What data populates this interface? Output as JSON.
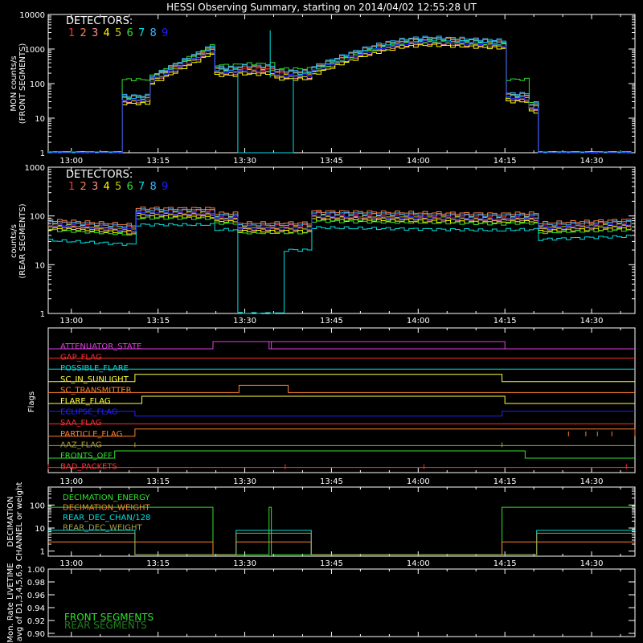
{
  "title": "HESSI Observing Summary, starting on 2014/04/02 12:55:28 UT",
  "colors": {
    "det1": "#ff3333",
    "det2": "#ff8040",
    "det3": "#ff9090",
    "det4": "#ffff00",
    "det5": "#c8c800",
    "det6": "#30e030",
    "det7": "#00e0e0",
    "det8": "#3cb4ff",
    "det9": "#2020ff",
    "magenta": "#e040e0",
    "red": "#ff3030",
    "cyan": "#00e0e0",
    "yellow": "#ffff40",
    "orange": "#ff8030",
    "blue": "#2020ff",
    "olive": "#a8a040",
    "green": "#30e030"
  },
  "chart_data": [
    {
      "type": "line",
      "name": "front",
      "ylabel": "MON counts/s\n(FRONT SEGMENTS)",
      "scale": "log",
      "ylim": [
        1,
        10000
      ],
      "yticks": [
        1,
        10,
        100,
        1000,
        10000
      ],
      "ytick_labels": [
        "1",
        "10",
        "100",
        "1000",
        "10000"
      ],
      "xlim_minutes": [
        -4,
        36.5
      ],
      "xticks": [
        [
          0,
          "13:00"
        ],
        [
          15,
          "13:15"
        ],
        [
          30,
          "13:30"
        ],
        [
          45,
          "13:45"
        ],
        [
          60,
          "14:00"
        ],
        [
          75,
          "14:15"
        ],
        [
          90,
          "14:30"
        ]
      ],
      "legend_title": "DETECTORS:",
      "legend_items": [
        "1",
        "2",
        "3",
        "4",
        "5",
        "6",
        "7",
        "8",
        "9"
      ]
    },
    {
      "type": "line",
      "name": "rear",
      "ylabel": "counts/s\n(REAR SEGMENTS)",
      "scale": "log",
      "ylim": [
        1,
        1000
      ],
      "yticks": [
        1,
        10,
        100,
        1000
      ],
      "ytick_labels": [
        "1",
        "10",
        "100",
        "1000"
      ],
      "legend_title": "DETECTORS:",
      "legend_items": [
        "1",
        "2",
        "3",
        "4",
        "5",
        "6",
        "7",
        "8",
        "9"
      ]
    },
    {
      "type": "flags",
      "ylabel": "Flags",
      "flags": [
        {
          "label": "ATTENUATOR_STATE",
          "color": "magenta"
        },
        {
          "label": "GAP_FLAG",
          "color": "red"
        },
        {
          "label": "POSSIBLE_FLARE",
          "color": "cyan"
        },
        {
          "label": "SC_IN_SUNLIGHT",
          "color": "yellow"
        },
        {
          "label": "SC_TRANSMITTER",
          "color": "orange"
        },
        {
          "label": "FLARE_FLAG",
          "color": "yellow"
        },
        {
          "label": "ECLIPSE_FLAG",
          "color": "blue"
        },
        {
          "label": "SAA_FLAG",
          "color": "red"
        },
        {
          "label": "PARTICLE_FLAG",
          "color": "orange"
        },
        {
          "label": "AAZ_FLAG",
          "color": "olive"
        },
        {
          "label": "FRONTS_OFF",
          "color": "green"
        },
        {
          "label": "BAD_PACKETS",
          "color": "red"
        }
      ]
    },
    {
      "type": "line",
      "name": "decimation",
      "ylabel": "DECIMATION\nCHANNEL or weight",
      "scale": "log",
      "ylim": [
        0.6,
        600
      ],
      "yticks": [
        1,
        10,
        100
      ],
      "ytick_labels": [
        "1",
        "10",
        "100"
      ],
      "legend_items": [
        {
          "label": "DECIMATION_ENERGY",
          "color": "green"
        },
        {
          "label": "DECIMATION_WEIGHT",
          "color": "orange"
        },
        {
          "label": "REAR_DEC_CHAN/128",
          "color": "cyan"
        },
        {
          "label": "REAR_DEC_WEIGHT",
          "color": "olive"
        }
      ]
    },
    {
      "type": "line",
      "name": "livetime",
      "ylabel": "Mon. Rate LIVETIME\navg of D1,3,4,5,6,9",
      "scale": "linear",
      "ylim": [
        0.895,
        1.0
      ],
      "yticks": [
        0.9,
        0.92,
        0.94,
        0.96,
        0.98,
        1.0
      ],
      "ytick_labels": [
        "0.90",
        "0.92",
        "0.94",
        "0.96",
        "0.98",
        "1.00"
      ],
      "legend_items": [
        {
          "label": "FRONT SEGMENTS",
          "color": "#30e030"
        },
        {
          "label": "REAR SEGMENTS",
          "color": "#208020"
        }
      ]
    }
  ]
}
